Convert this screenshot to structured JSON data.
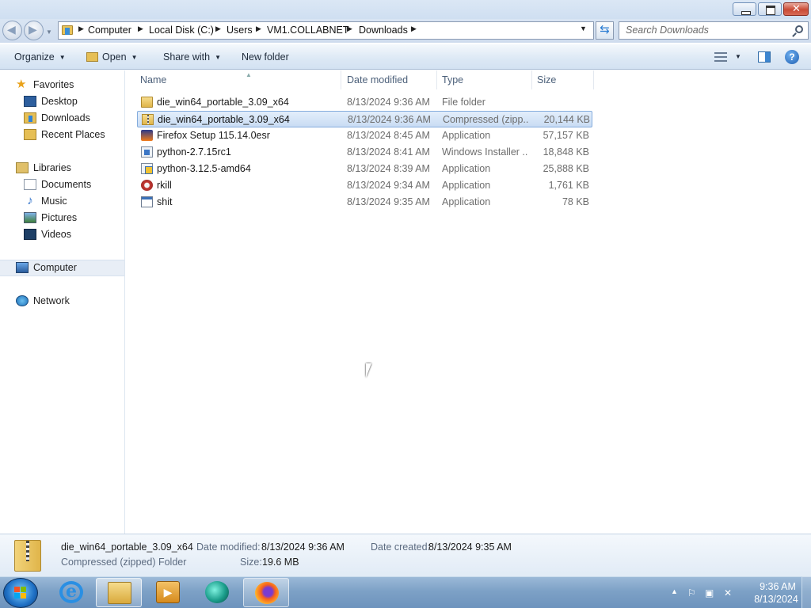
{
  "window": {
    "buttons": {
      "minimize": "minimize",
      "maximize": "maximize",
      "close": "close"
    }
  },
  "address": {
    "breadcrumbs": [
      "Computer",
      "Local Disk (C:)",
      "Users",
      "VM1.COLLABNET",
      "Downloads"
    ],
    "search_placeholder": "Search Downloads"
  },
  "toolbar": {
    "organize": "Organize",
    "open": "Open",
    "share_with": "Share with",
    "new_folder": "New folder"
  },
  "nav": {
    "favorites": "Favorites",
    "desktop": "Desktop",
    "downloads": "Downloads",
    "recent_places": "Recent Places",
    "libraries": "Libraries",
    "documents": "Documents",
    "music": "Music",
    "pictures": "Pictures",
    "videos": "Videos",
    "computer": "Computer",
    "network": "Network"
  },
  "columns": {
    "name": "Name",
    "date_modified": "Date modified",
    "type": "Type",
    "size": "Size"
  },
  "files": [
    {
      "name": "die_win64_portable_3.09_x64",
      "date": "8/13/2024 9:36 AM",
      "type": "File folder",
      "size": "",
      "icon": "folder-icon"
    },
    {
      "name": "die_win64_portable_3.09_x64",
      "date": "8/13/2024 9:36 AM",
      "type": "Compressed (zipp...",
      "size": "20,144 KB",
      "icon": "zip-folder-icon",
      "selected": true
    },
    {
      "name": "Firefox Setup 115.14.0esr",
      "date": "8/13/2024 8:45 AM",
      "type": "Application",
      "size": "57,157 KB",
      "icon": "firefox-setup-icon"
    },
    {
      "name": "python-2.7.15rc1",
      "date": "8/13/2024 8:41 AM",
      "type": "Windows Installer ...",
      "size": "18,848 KB",
      "icon": "msi-installer-icon"
    },
    {
      "name": "python-3.12.5-amd64",
      "date": "8/13/2024 8:39 AM",
      "type": "Application",
      "size": "25,888 KB",
      "icon": "setup-icon"
    },
    {
      "name": "rkill",
      "date": "8/13/2024 9:34 AM",
      "type": "Application",
      "size": "1,761 KB",
      "icon": "rkill-icon"
    },
    {
      "name": "shit",
      "date": "8/13/2024 9:35 AM",
      "type": "Application",
      "size": "78 KB",
      "icon": "exe-icon"
    }
  ],
  "details": {
    "name": "die_win64_portable_3.09_x64",
    "type": "Compressed (zipped) Folder",
    "date_modified_label": "Date modified:",
    "date_modified": "8/13/2024 9:36 AM",
    "date_created_label": "Date created:",
    "date_created": "8/13/2024 9:35 AM",
    "size_label": "Size:",
    "size": "19.6 MB"
  },
  "taskbar": {
    "items": [
      "internet-explorer",
      "windows-explorer",
      "media-player",
      "app",
      "firefox"
    ],
    "clock_time": "9:36 AM",
    "clock_date": "8/13/2024"
  },
  "colors": {
    "selection": "#c9dcf3",
    "selection_border": "#84acdd",
    "taskbar": "#7da1c6"
  }
}
